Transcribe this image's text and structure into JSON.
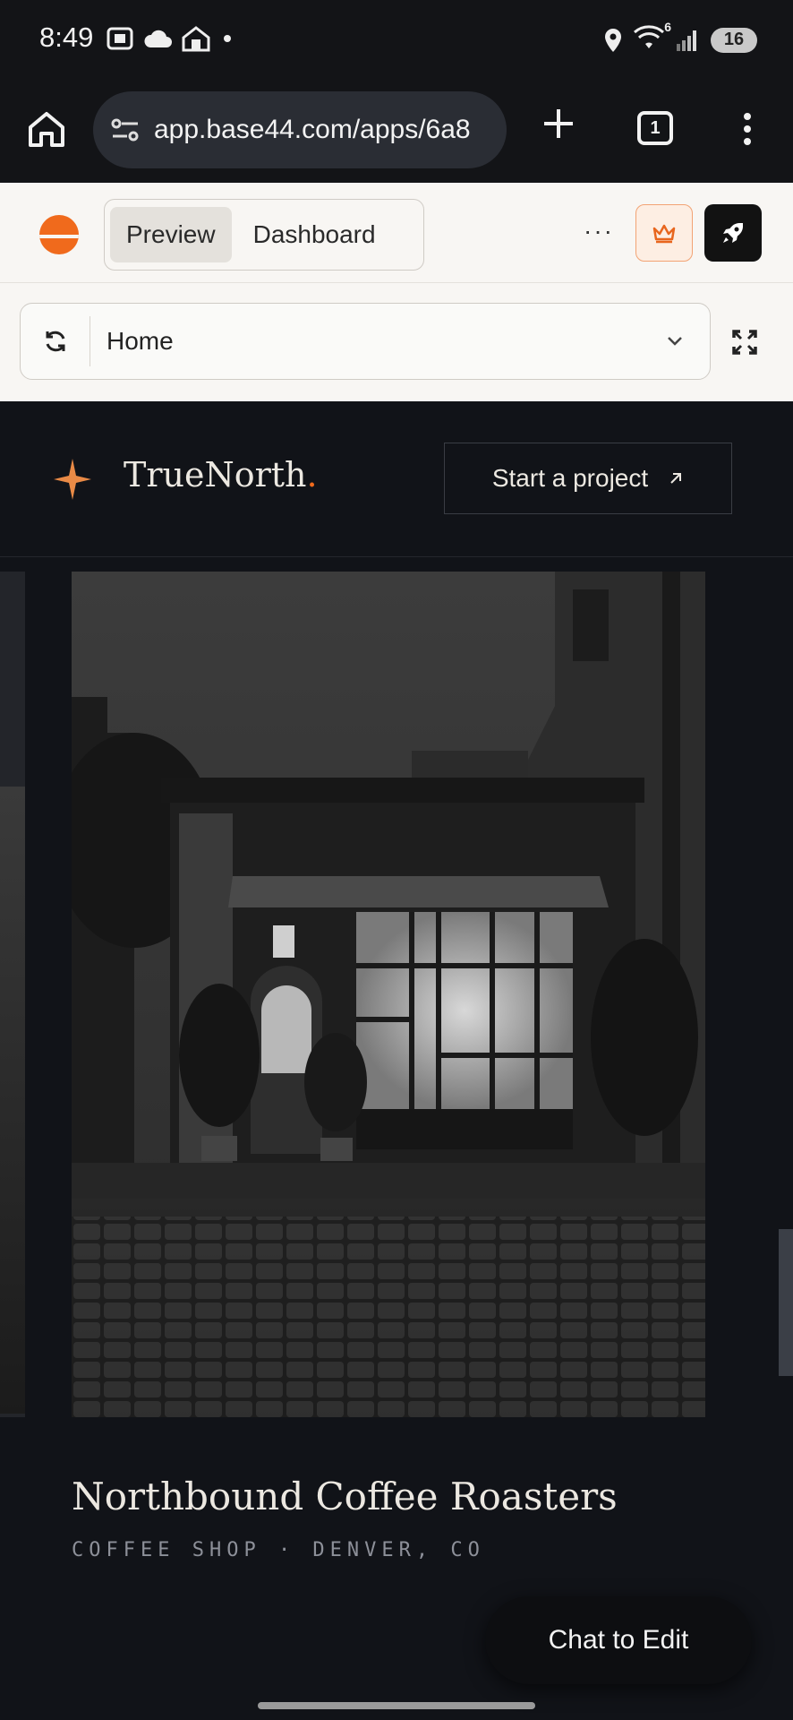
{
  "status_bar": {
    "time": "8:49",
    "battery": "16",
    "wifi_superscript": "6"
  },
  "browser": {
    "url": "app.base44.com/apps/6a8",
    "tab_count": "1"
  },
  "app_toolbar": {
    "tabs": [
      {
        "label": "Preview",
        "active": true
      },
      {
        "label": "Dashboard",
        "active": false
      }
    ],
    "more": "···",
    "accent_color": "#f06a1c"
  },
  "page_bar": {
    "current_page": "Home"
  },
  "site": {
    "brand_name": "TrueNorth",
    "brand_dot": ".",
    "cta_label": "Start a project",
    "project_title": "Northbound Coffee Roasters",
    "project_meta": "COFFEE SHOP · DENVER, CO"
  },
  "chat_button": "Chat to Edit"
}
